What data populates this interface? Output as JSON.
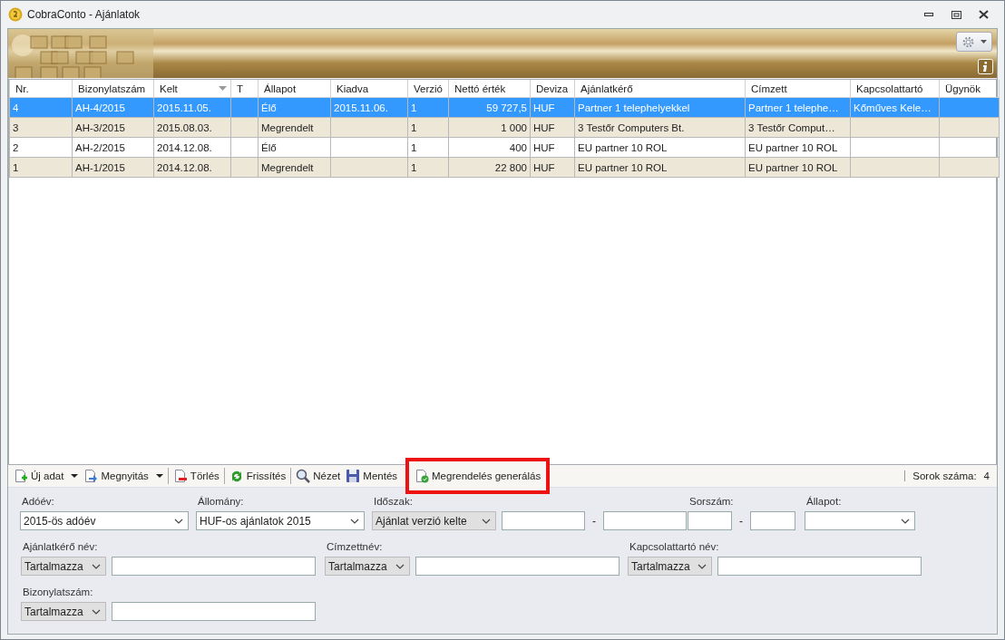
{
  "window": {
    "title": "CobraConto - Ajánlatok"
  },
  "table": {
    "columns": [
      {
        "label": "Nr.",
        "sorted": false
      },
      {
        "label": "Bizonylatszám",
        "sorted": false
      },
      {
        "label": "Kelt",
        "sorted": true
      },
      {
        "label": "T",
        "sorted": false
      },
      {
        "label": "Állapot",
        "sorted": false
      },
      {
        "label": "Kiadva",
        "sorted": false
      },
      {
        "label": "Verzió",
        "sorted": false
      },
      {
        "label": "Nettó érték",
        "sorted": false
      },
      {
        "label": "Deviza",
        "sorted": false
      },
      {
        "label": "Ajánlatkérő",
        "sorted": false
      },
      {
        "label": "Címzett",
        "sorted": false
      },
      {
        "label": "Kapcsolattartó",
        "sorted": false
      },
      {
        "label": "Ügynök",
        "sorted": false
      }
    ],
    "rows": [
      {
        "selected": true,
        "cells": [
          "4",
          "AH-4/2015",
          "2015.11.05.",
          null,
          "Élő",
          "2015.11.06.",
          "1",
          "59 727,5",
          "HUF",
          "Partner 1 telephelyekkel",
          "Partner 1 telephe…",
          "Kőműves Kele…",
          null
        ]
      },
      {
        "selected": false,
        "cells": [
          "3",
          "AH-3/2015",
          "2015.08.03.",
          null,
          "Megrendelt",
          null,
          "1",
          "1 000",
          "HUF",
          "3 Testőr Computers Bt.",
          "3 Testőr Comput…",
          null,
          null
        ]
      },
      {
        "selected": false,
        "cells": [
          "2",
          "AH-2/2015",
          "2014.12.08.",
          null,
          "Élő",
          null,
          "1",
          "400",
          "HUF",
          "EU partner 10 ROL",
          "EU partner 10 ROL",
          null,
          null
        ]
      },
      {
        "selected": false,
        "cells": [
          "1",
          "AH-1/2015",
          "2014.12.08.",
          null,
          "Megrendelt",
          null,
          "1",
          "22 800",
          "HUF",
          "EU partner 10 ROL",
          "EU partner 10 ROL",
          null,
          null
        ]
      }
    ]
  },
  "toolbar": {
    "groups": [
      [
        {
          "kind": "new",
          "label": "Új adat",
          "dropdown": true,
          "highlighted": false
        },
        {
          "kind": "open",
          "label": "Megnyitás",
          "dropdown": true,
          "highlighted": false
        }
      ],
      [
        {
          "kind": "delete",
          "label": "Törlés",
          "dropdown": false,
          "highlighted": false
        }
      ],
      [
        {
          "kind": "refresh",
          "label": "Frissítés",
          "dropdown": false,
          "highlighted": false
        }
      ],
      [
        {
          "kind": "view",
          "label": "Nézet",
          "dropdown": false,
          "highlighted": false
        },
        {
          "kind": "save",
          "label": "Mentés",
          "dropdown": false,
          "highlighted": false
        },
        {
          "kind": "generate",
          "label": "Megrendelés generálás",
          "dropdown": false,
          "highlighted": true
        }
      ]
    ],
    "row_count": {
      "label": "Sorok száma:",
      "value": "4"
    }
  },
  "filters": [
    [
      {
        "kind": "combo",
        "label": "Adóév:",
        "value": "2015-ös adóév"
      },
      {
        "kind": "combo",
        "label": "Állomány:",
        "value": "HUF-os ajánlatok 2015"
      },
      {
        "kind": "period",
        "label": "Időszak:",
        "mode": "Ajánlat verzió kelte",
        "separator": "-"
      },
      {
        "kind": "range",
        "label": "Sorszám:",
        "separator": "-"
      },
      {
        "kind": "combo",
        "label": "Állapot:"
      }
    ],
    [
      {
        "kind": "match",
        "label": "Ajánlatkérő név:",
        "mode": "Tartalmazza"
      },
      {
        "kind": "match",
        "label": "Címzettnév:",
        "mode": "Tartalmazza"
      },
      {
        "kind": "match",
        "label": "Kapcsolattartó név:",
        "mode": "Tartalmazza"
      }
    ],
    [
      {
        "kind": "match",
        "label": "Bizonylatszám:",
        "mode": "Tartalmazza"
      }
    ]
  ]
}
